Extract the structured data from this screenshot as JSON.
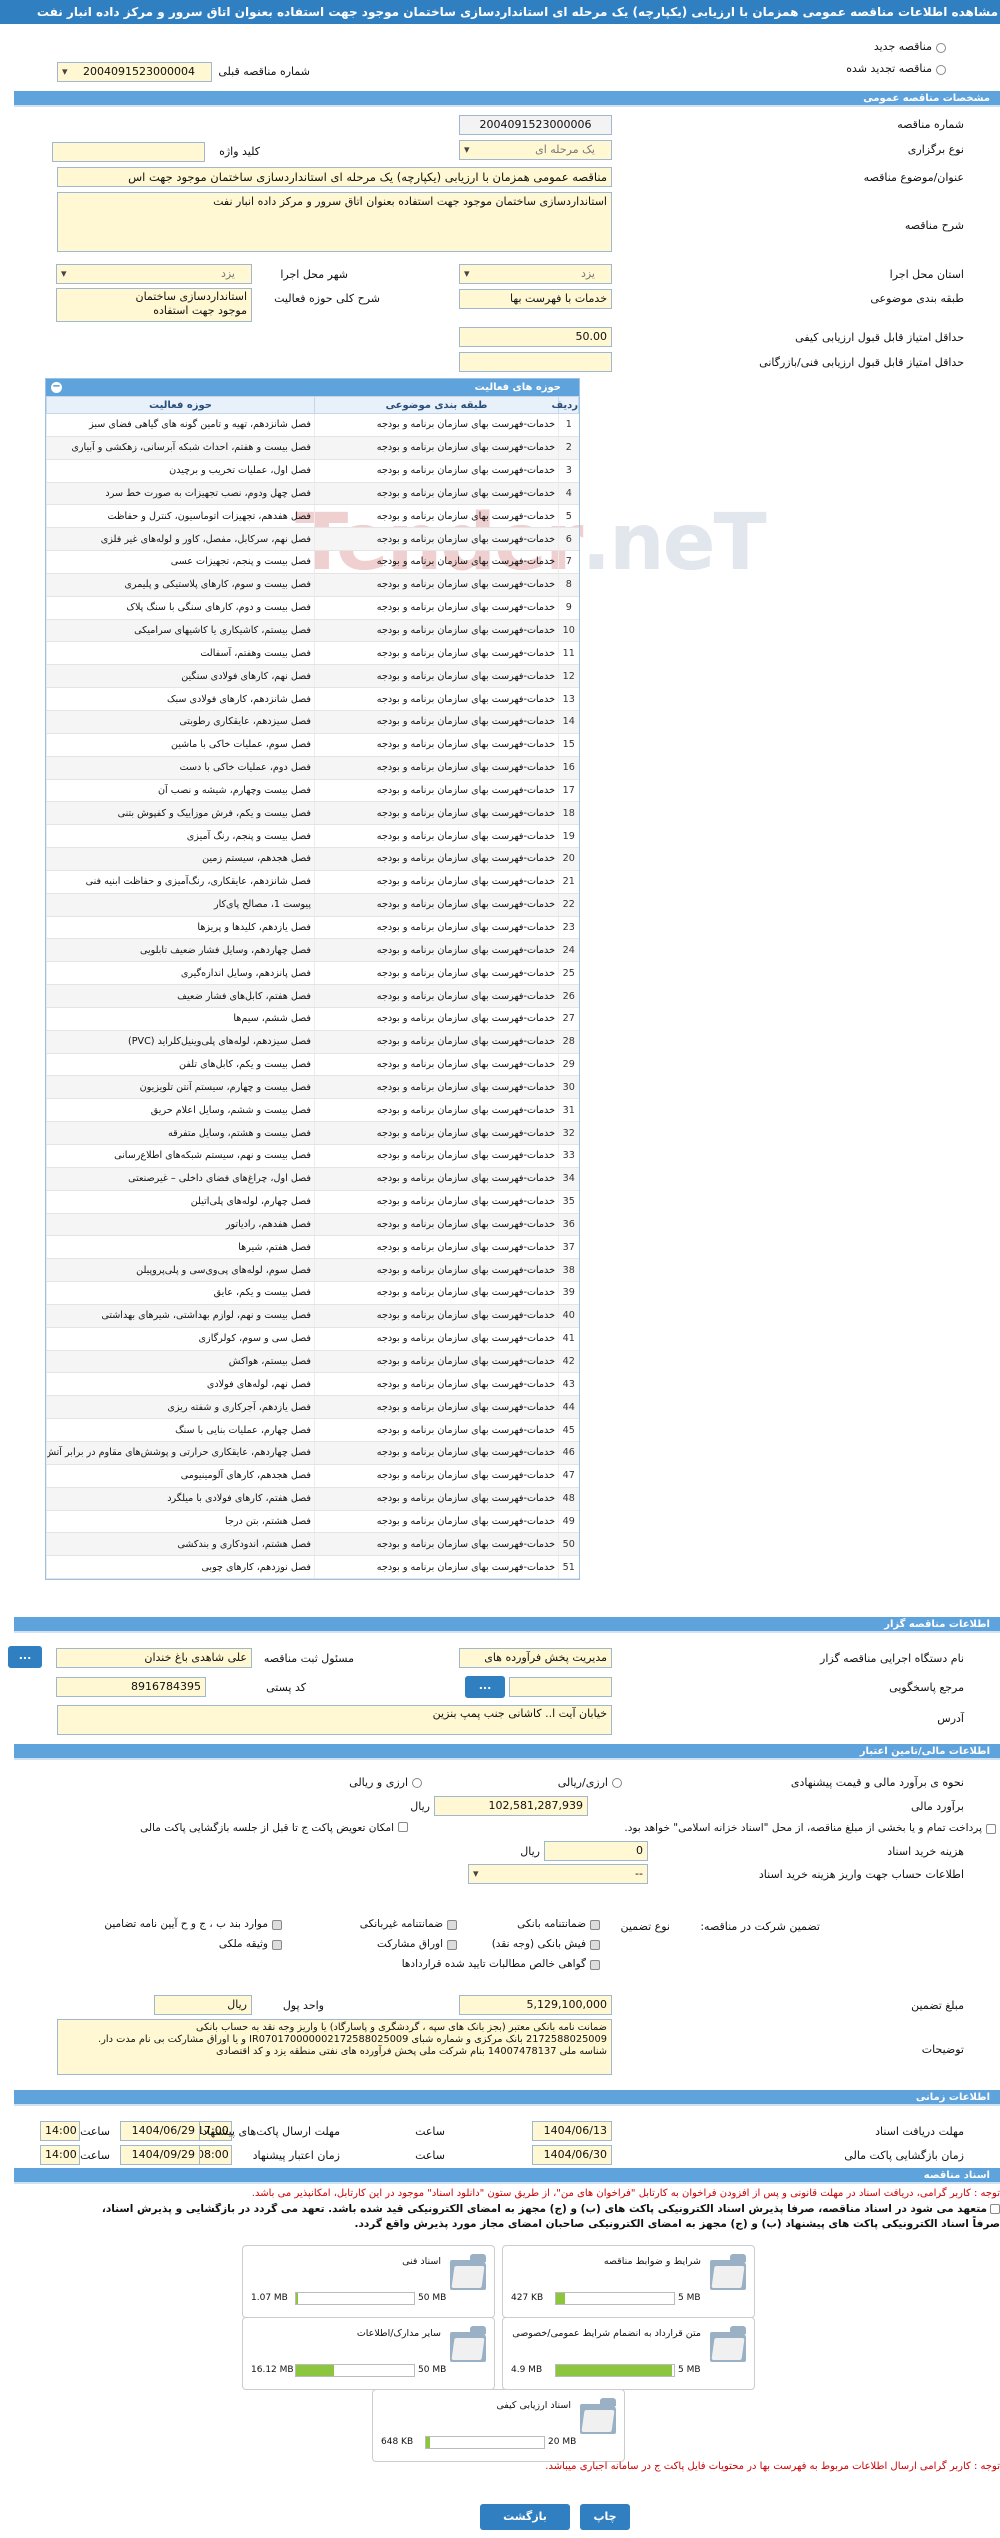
{
  "title": "مشاهده اطلاعات مناقصه عمومی همزمان با ارزیابی (یکپارچه) یک مرحله ای استانداردسازی ساختمان موجود جهت استفاده بعنوان اتاق سرور و مرکز داده انبار نفت",
  "top": {
    "new_tender": "مناقصه جدید",
    "renewed_tender": "مناقصه تجدید شده",
    "previous_number_label": "شماره مناقصه قبلی",
    "previous_number": "2004091523000004"
  },
  "sections": {
    "general": "مشخصات مناقصه عمومی",
    "activity": "حوزه های فعالیت",
    "organizer": "اطلاعات مناقصه گزار",
    "financial": "اطلاعات مالی/تامین اعتبار",
    "timing": "اطلاعات زمانی",
    "documents": "اسناد مناقصه"
  },
  "general": {
    "number_label": "شماره مناقصه",
    "number": "2004091523000006",
    "type_label": "نوع برگزاری",
    "type": "یک مرحله ای",
    "keyword_label": "کلید واژه",
    "keyword": "",
    "subject_label": "عنوان/موضوع مناقصه",
    "subject": "مناقصه عمومی همزمان با ارزیابی (یکپارچه) یک مرحله ای استانداردسازی ساختمان موجود جهت اس",
    "desc_label": "شرح مناقصه",
    "desc": "استانداردسازی ساختمان موجود جهت استفاده بعنوان اتاق سرور و مرکز داده انبار نفت",
    "province_label": "استان محل اجرا",
    "province": "یزد",
    "city_label": "شهر محل اجرا",
    "city": "یزد",
    "category_label": "طبقه بندی موضوعی",
    "category": "خدمات با فهرست بها",
    "scope_label": "شرح کلی حوزه فعالیت",
    "scope_lines": [
      "استانداردسازی ساختمان",
      "موجود جهت استفاده"
    ],
    "min_quality_label": "حداقل امتیاز قابل قبول ارزیابی کیفی",
    "min_quality": "50.00",
    "min_tech_label": "حداقل امتیاز قابل قبول ارزیابی فنی/بازرگانی",
    "min_tech": ""
  },
  "activity_table": {
    "col_row": "ردیف",
    "col_category": "طبقه بندی موضوعی",
    "col_field": "حوزه فعالیت",
    "rows": [
      [
        "1",
        "خدمات-فهرست بهای سازمان برنامه و بودجه",
        "فصل شانزدهم، تهیه و تامین گونه های گیاهی فضای سبز"
      ],
      [
        "2",
        "خدمات-فهرست بهای سازمان برنامه و بودجه",
        "فصل بیست و هفتم، احداث شبکه آبرسانی، زهکشی و آبیاری"
      ],
      [
        "3",
        "خدمات-فهرست بهای سازمان برنامه و بودجه",
        "فصل اول، عملیات تخریب و برچیدن"
      ],
      [
        "4",
        "خدمات-فهرست بهای سازمان برنامه و بودجه",
        "فصل چهل ودوم، نصب تجهیزات به صورت خط سرد"
      ],
      [
        "5",
        "خدمات-فهرست بهای سازمان برنامه و بودجه",
        "فصل هفدهم، تجهیزات اتوماسیون، کنترل و حفاظت"
      ],
      [
        "6",
        "خدمات-فهرست بهای سازمان برنامه و بودجه",
        "فصل نهم، سرکابل، مفصل، کاور و لوله‌های غیر فلزی"
      ],
      [
        "7",
        "خدمات-فهرست بهای سازمان برنامه و بودجه",
        "فصل بیست و پنجم، تجهیزات عسی"
      ],
      [
        "8",
        "خدمات-فهرست بهای سازمان برنامه و بودجه",
        "فصل بیست و سوم، کارهای پلاستیکی و پلیمری"
      ],
      [
        "9",
        "خدمات-فهرست بهای سازمان برنامه و بودجه",
        "فصل بیست و دوم، کارهای سنگی با سنگ پلاک"
      ],
      [
        "10",
        "خدمات-فهرست بهای سازمان برنامه و بودجه",
        "فصل بیستم، کاشیکاری یا کاشیهای سرامیکی"
      ],
      [
        "11",
        "خدمات-فهرست بهای سازمان برنامه و بودجه",
        "فصل بیست وهفتم، آسفالت"
      ],
      [
        "12",
        "خدمات-فهرست بهای سازمان برنامه و بودجه",
        "فصل نهم، کارهای فولادی سنگین"
      ],
      [
        "13",
        "خدمات-فهرست بهای سازمان برنامه و بودجه",
        "فصل شانزدهم، کارهای فولادی سبک"
      ],
      [
        "14",
        "خدمات-فهرست بهای سازمان برنامه و بودجه",
        "فصل سیزدهم، عایقکاری رطوبتی"
      ],
      [
        "15",
        "خدمات-فهرست بهای سازمان برنامه و بودجه",
        "فصل سوم، عملیات خاکی با ماشین"
      ],
      [
        "16",
        "خدمات-فهرست بهای سازمان برنامه و بودجه",
        "فصل دوم، عملیات خاکی با دست"
      ],
      [
        "17",
        "خدمات-فهرست بهای سازمان برنامه و بودجه",
        "فصل بیست وچهارم، شیشه و نصب آن"
      ],
      [
        "18",
        "خدمات-فهرست بهای سازمان برنامه و بودجه",
        "فصل بیست و یکم، فرش موزاییک و کفپوش بتنی"
      ],
      [
        "19",
        "خدمات-فهرست بهای سازمان برنامه و بودجه",
        "فصل بیست و پنجم، رنگ آمیزی"
      ],
      [
        "20",
        "خدمات-فهرست بهای سازمان برنامه و بودجه",
        "فصل هجدهم، سیستم زمین"
      ],
      [
        "21",
        "خدمات-فهرست بهای سازمان برنامه و بودجه",
        "فصل شانزدهم، عایقکاری، رنگ‌آمیزی و حفاظت ابنیه فنی"
      ],
      [
        "22",
        "خدمات-فهرست بهای سازمان برنامه و بودجه",
        "پیوست 1، مصالح پای‌کار"
      ],
      [
        "23",
        "خدمات-فهرست بهای سازمان برنامه و بودجه",
        "فصل یازدهم، کلیدها و پریزها"
      ],
      [
        "24",
        "خدمات-فهرست بهای سازمان برنامه و بودجه",
        "فصل چهاردهم، وسایل فشار ضعیف تابلویی"
      ],
      [
        "25",
        "خدمات-فهرست بهای سازمان برنامه و بودجه",
        "فصل پانزدهم، وسایل اندازه‌گیری"
      ],
      [
        "26",
        "خدمات-فهرست بهای سازمان برنامه و بودجه",
        "فصل هفتم، کابل‌های فشار ضعیف"
      ],
      [
        "27",
        "خدمات-فهرست بهای سازمان برنامه و بودجه",
        "فصل ششم، سیم‌ها"
      ],
      [
        "28",
        "خدمات-فهرست بهای سازمان برنامه و بودجه",
        "فصل سیزدهم، لوله‌های پلی‌وینیل‌کلراید (PVC)"
      ],
      [
        "29",
        "خدمات-فهرست بهای سازمان برنامه و بودجه",
        "فصل بیست و یکم، کابل‌های تلفن"
      ],
      [
        "30",
        "خدمات-فهرست بهای سازمان برنامه و بودجه",
        "فصل بیست و چهارم، سیستم آنتن تلویزیون"
      ],
      [
        "31",
        "خدمات-فهرست بهای سازمان برنامه و بودجه",
        "فصل بیست و ششم، وسایل اعلام حریق"
      ],
      [
        "32",
        "خدمات-فهرست بهای سازمان برنامه و بودجه",
        "فصل بیست و هشتم، وسایل متفرقه"
      ],
      [
        "33",
        "خدمات-فهرست بهای سازمان برنامه و بودجه",
        "فصل بیست و نهم، سیستم شبکه‌های اطلاع‌رسانی"
      ],
      [
        "34",
        "خدمات-فهرست بهای سازمان برنامه و بودجه",
        "فصل اول، چراغ‌های فضای داخلی – غیرصنعتی"
      ],
      [
        "35",
        "خدمات-فهرست بهای سازمان برنامه و بودجه",
        "فصل چهارم، لوله‌های پلی‌اتیلن"
      ],
      [
        "36",
        "خدمات-فهرست بهای سازمان برنامه و بودجه",
        "فصل هفدهم، رادیاتور"
      ],
      [
        "37",
        "خدمات-فهرست بهای سازمان برنامه و بودجه",
        "فصل هفتم، شیرها"
      ],
      [
        "38",
        "خدمات-فهرست بهای سازمان برنامه و بودجه",
        "فصل سوم، لوله‌های پی‌وی‌سی و پلی‌پروپیلن"
      ],
      [
        "39",
        "خدمات-فهرست بهای سازمان برنامه و بودجه",
        "فصل بیست و یکم، عایق"
      ],
      [
        "40",
        "خدمات-فهرست بهای سازمان برنامه و بودجه",
        "فصل بیست و نهم، لوازم بهداشتی، شیرهای بهداشتی"
      ],
      [
        "41",
        "خدمات-فهرست بهای سازمان برنامه و بودجه",
        "فصل سی و سوم، کولرگازی"
      ],
      [
        "42",
        "خدمات-فهرست بهای سازمان برنامه و بودجه",
        "فصل بیستم، هواکش"
      ],
      [
        "43",
        "خدمات-فهرست بهای سازمان برنامه و بودجه",
        "فصل نهم، لوله‌های فولادی"
      ],
      [
        "44",
        "خدمات-فهرست بهای سازمان برنامه و بودجه",
        "فصل یازدهم، آجرکاری و شفته ریزی"
      ],
      [
        "45",
        "خدمات-فهرست بهای سازمان برنامه و بودجه",
        "فصل چهارم، عملیات بنایی با سنگ"
      ],
      [
        "46",
        "خدمات-فهرست بهای سازمان برنامه و بودجه",
        "فصل چهاردهم، عایقکاری حرارتی و پوشش‌های مقاوم در برابر آتش"
      ],
      [
        "47",
        "خدمات-فهرست بهای سازمان برنامه و بودجه",
        "فصل هجدهم، کارهای آلومینیومی"
      ],
      [
        "48",
        "خدمات-فهرست بهای سازمان برنامه و بودجه",
        "فصل هفتم، کارهای فولادی با میلگرد"
      ],
      [
        "49",
        "خدمات-فهرست بهای سازمان برنامه و بودجه",
        "فصل هشتم، بتن درجا"
      ],
      [
        "50",
        "خدمات-فهرست بهای سازمان برنامه و بودجه",
        "فصل هشتم، اندودکاری و بندکشی"
      ],
      [
        "51",
        "خدمات-فهرست بهای سازمان برنامه و بودجه",
        "فصل نوزدهم، کارهای چوبی"
      ]
    ]
  },
  "organizer": {
    "device_label": "نام دستگاه اجرایی مناقصه گزار",
    "device": "مدیریت پخش فرآورده های",
    "registrar_label": "مسئول ثبت مناقصه",
    "registrar": "علی شاهدی باغ خندان",
    "reference_label": "مرجع پاسخگویی",
    "reference": "",
    "postal_label": "کد پستی",
    "postal": "8916784395",
    "address_label": "آدرس",
    "address": "خیابان آیت ا.. کاشانی جنب پمپ بنزین",
    "more_btn": "...",
    "lookup_btn": "..."
  },
  "financial": {
    "estimate_type_label": "نحوه ی برآورد مالی و قیمت پیشنهادی",
    "opt_rial": "ارزی/ریالی",
    "opt_fx": "ارزی و ریالی",
    "estimate_label": "برآورد مالی",
    "estimate": "102,581,287,939",
    "currency": "ریال",
    "payment_label": "پرداخت تمام و یا بخشی از مبلغ مناقصه، از محل \"اسناد خزانه اسلامی\" خواهد بود.",
    "comp_label": "امکان تعویض پاکت ج تا قبل از جلسه بازگشایی پاکت مالی",
    "doc_cost_label": "هزینه خرید اسناد",
    "doc_cost": "0",
    "doc_cost_unit": "ریال",
    "account_label": "اطلاعات حساب جهت واریز هزینه خرید اسناد",
    "account": "--",
    "guarantee_label": "تضمین شرکت در مناقصه:",
    "guarantee_type_label": "نوع تضمین",
    "g_opts": [
      "ضمانتنامه بانکی",
      "ضمانتنامه غیربانکی",
      "موارد بند ب ، ج و ح آیین نامه تضامین",
      "فیش بانکی (وجه نقد)",
      "اوراق مشارکت",
      "وثیقه ملکی",
      "گواهی خالص مطالبات تایید شده قراردادها"
    ],
    "g_amount_label": "مبلغ تضمین",
    "g_amount": "5,129,100,000",
    "g_unit_label": "واحد پول",
    "g_unit": "ریال",
    "notes_label": "توضیحات",
    "notes": [
      "ضمانت نامه بانکی معتبر (بجز بانک های سپه ، گردشگری و پاسارگاد) یا واریز وجه نقد به حساب بانکی",
      "2172588025009 بانک مرکزی و شماره شبای IR070170000002172588025009 و یا اوراق مشارکت بی نام مدت دار.",
      "شناسه ملی 14007478137 بنام شرکت ملی پخش فرآورده های نفتی منطقه یزد و کد اقتصادی"
    ]
  },
  "timing": {
    "receive_label": "مهلت دریافت اسناد",
    "receive_date": "1404/06/13",
    "receive_time": "17:00",
    "send_label": "مهلت ارسال پاکت‌های پیشنهاد",
    "send_date": "1404/06/29",
    "send_time": "14:00",
    "open_label": "زمان بازگشایی پاکت مالی",
    "open_date": "1404/06/30",
    "open_time": "08:00",
    "validity_label": "زمان اعتبار پیشنهاد",
    "validity_date": "1404/09/29",
    "validity_time": "14:00",
    "time_label": "ساعت"
  },
  "documents": {
    "warn1": "توجه : کاربر گرامی، دریافت اسناد در مهلت قانونی و پس از افزودن فراخوان به کارتابل \"فراخوان های من\"، از طریق ستون \"دانلود اسناد\" موجود در این کارتابل، امکانپذیر می باشد.",
    "commit1": "متعهد می شود در اسناد مناقصه، صرفاً پذیرش اسناد الکترونیکی پاکت های (ب) و (ج) مجهز به امضای الکترونیکی قید شده باشد. تعهد می گردد در بازگشایی و پذیرش اسناد،",
    "commit2": "صرفاً اسناد الکترونیکی پاکت های پیشنهاد (ب) و (ج) مجهز به امضای الکترونیکی صاحبان امضای مجاز مورد پذیرش واقع گردد.",
    "files": [
      {
        "name": "شرایط و ضوابط مناقصه",
        "size": "427 KB",
        "max": "5 MB",
        "fill": 0.08
      },
      {
        "name": "اسناد فنی",
        "size": "1.07 MB",
        "max": "50 MB",
        "fill": 0.02
      },
      {
        "name": "متن قرارداد به انضمام شرایط عمومی/خصوصی",
        "size": "4.9 MB",
        "max": "5 MB",
        "fill": 0.98
      },
      {
        "name": "سایر مدارک/اطلاعات",
        "size": "16.12 MB",
        "max": "50 MB",
        "fill": 0.32
      },
      {
        "name": "اسناد ارزیابی کیفی",
        "size": "648 KB",
        "max": "20 MB",
        "fill": 0.03
      }
    ],
    "warn2": "توجه : کاربر گرامی ارسال اطلاعات مربوط به فهرست بها در محتویات فایل پاکت ج در سامانه اجباری میباشد."
  },
  "buttons": {
    "print": "چاپ",
    "back": "بازگشت"
  },
  "watermark": {
    "a": "Tender",
    "b": ".neT"
  }
}
